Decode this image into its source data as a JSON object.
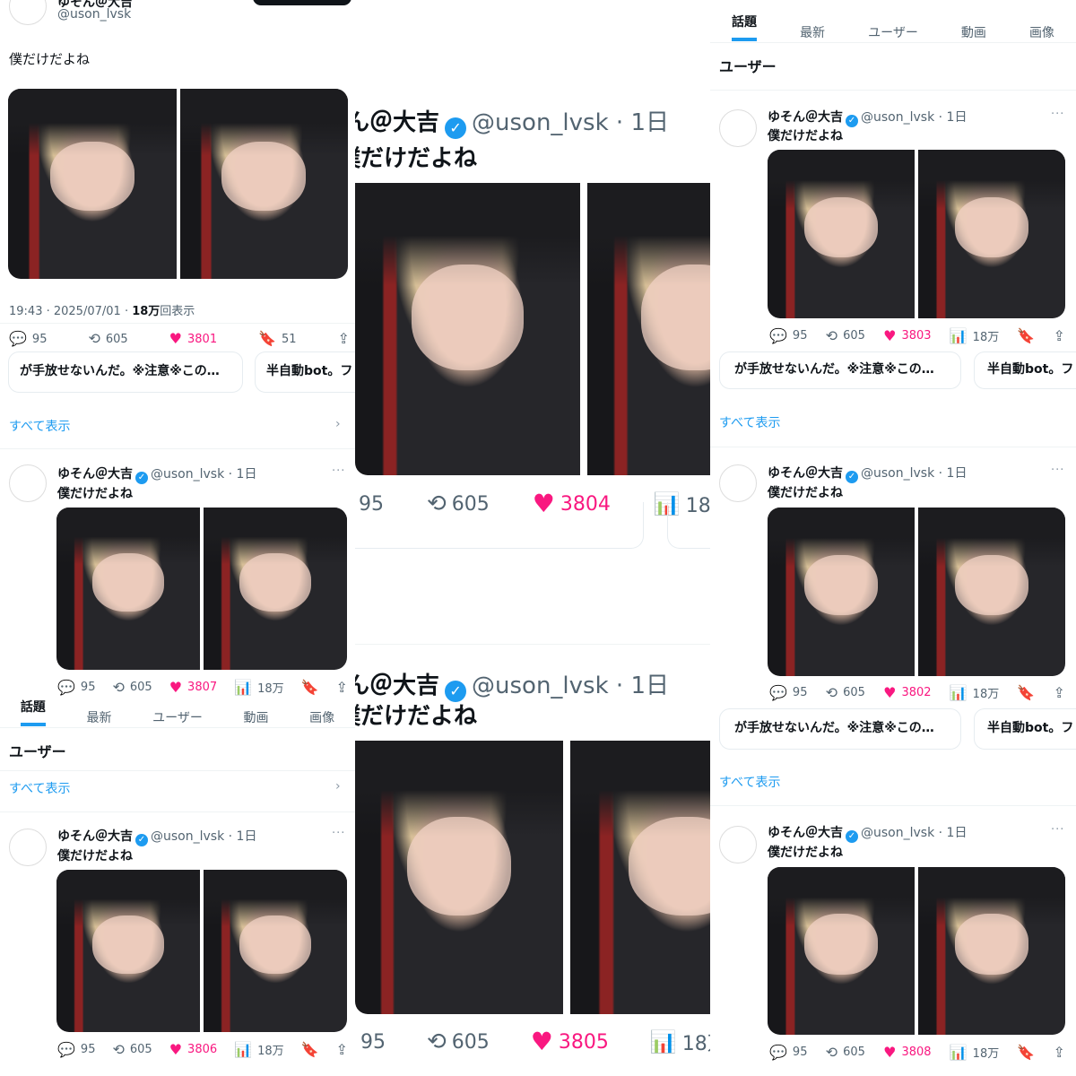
{
  "profile": {
    "name": "ゆそん＠大吉",
    "handle": "@uson_lvsk",
    "age": "1日",
    "tweet_text": "僕だけだよね",
    "verified_icon": "verified-badge-icon",
    "avatar": "avatar-image"
  },
  "detail": {
    "date": "19:43 · 2025/07/01",
    "views_num": "18万",
    "views_label": "回表示",
    "replies": "95",
    "retweets": "605",
    "likes": "3801",
    "bookmarks": "51"
  },
  "tabs": [
    "話題",
    "最新",
    "ユーザー",
    "動画",
    "画像"
  ],
  "section_users": "ユーザー",
  "see_all": "すべて表示",
  "quote_snippets": [
    "が手放せないんだ。※注意※この…",
    "半自動bot。フ"
  ],
  "counts": {
    "replies": "95",
    "retweets": "605",
    "views": "18万"
  },
  "likes": {
    "col1_mid": "3807",
    "col1_bottom": "3806",
    "col2_top": "3804",
    "col2_bottom": "3805",
    "col3_top": "3803",
    "col3_mid": "3802",
    "col3_bottom": "3808"
  },
  "colors": {
    "accent": "#1d9bf0",
    "like": "#f91880",
    "muted": "#536471"
  }
}
